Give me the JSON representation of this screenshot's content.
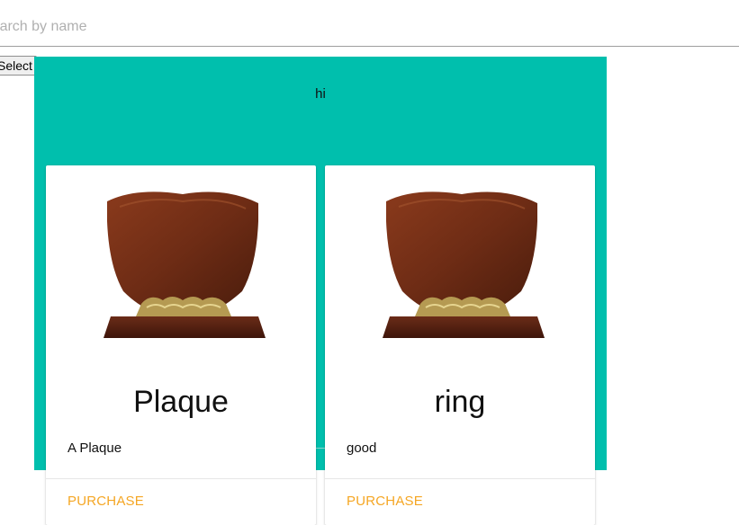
{
  "search": {
    "placeholder": "Search by name"
  },
  "toolbar": {
    "select_label": "Select"
  },
  "hero": {
    "text": "hi",
    "background_color": "#00bfad"
  },
  "cards": [
    {
      "title": "Plaque",
      "description": "A Plaque",
      "action_label": "PURCHASE",
      "image_icon": "trophy-plaque-image"
    },
    {
      "title": "ring",
      "description": "good",
      "action_label": "PURCHASE",
      "image_icon": "trophy-plaque-image"
    }
  ],
  "colors": {
    "accent": "#f5a623",
    "hero": "#00bfad"
  }
}
